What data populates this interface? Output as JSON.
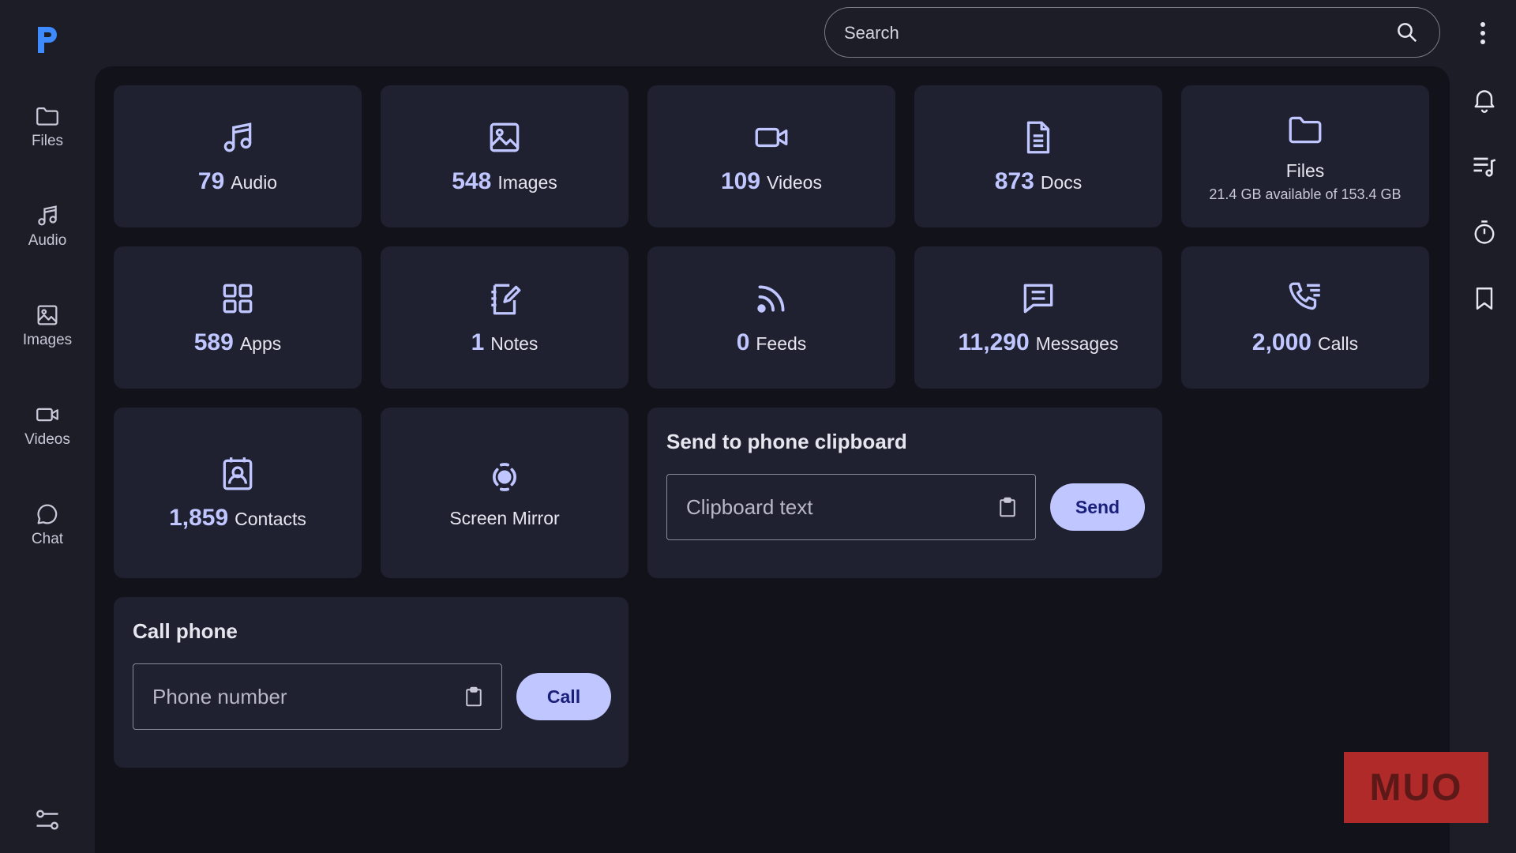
{
  "colors": {
    "accent": "#c0c6ff",
    "surface": "#1f2030",
    "background": "#12121a",
    "sidebar": "#1c1d26"
  },
  "nav": {
    "logo": "p-logo",
    "items": [
      {
        "label": "Files",
        "icon": "folder-icon"
      },
      {
        "label": "Audio",
        "icon": "music-note-icon"
      },
      {
        "label": "Images",
        "icon": "image-icon"
      },
      {
        "label": "Videos",
        "icon": "video-camera-icon"
      },
      {
        "label": "Chat",
        "icon": "chat-bubble-icon"
      }
    ],
    "settings_icon": "sliders-icon"
  },
  "search": {
    "placeholder": "Search",
    "icon": "search-icon"
  },
  "right_bar": {
    "icons": [
      "bell-icon",
      "playlist-icon",
      "timer-icon",
      "bookmark-icon"
    ],
    "menu_icon": "more-vertical-icon"
  },
  "stats": [
    {
      "count": "79",
      "label": "Audio",
      "icon": "music-note-icon"
    },
    {
      "count": "548",
      "label": "Images",
      "icon": "image-icon"
    },
    {
      "count": "109",
      "label": "Videos",
      "icon": "video-camera-icon"
    },
    {
      "count": "873",
      "label": "Docs",
      "icon": "document-icon"
    },
    {
      "label": "Files",
      "sub": "21.4 GB available of 153.4 GB",
      "icon": "folder-icon"
    },
    {
      "count": "589",
      "label": "Apps",
      "icon": "apps-grid-icon"
    },
    {
      "count": "1",
      "label": "Notes",
      "icon": "notes-icon"
    },
    {
      "count": "0",
      "label": "Feeds",
      "icon": "rss-feed-icon"
    },
    {
      "count": "11,290",
      "label": "Messages",
      "icon": "message-icon"
    },
    {
      "count": "2,000",
      "label": "Calls",
      "icon": "call-log-icon"
    },
    {
      "count": "1,859",
      "label": "Contacts",
      "icon": "contact-icon"
    },
    {
      "label": "Screen Mirror",
      "icon": "screen-mirror-icon"
    }
  ],
  "clipboard": {
    "title": "Send to phone clipboard",
    "placeholder": "Clipboard text",
    "button": "Send",
    "icon": "clipboard-icon"
  },
  "call": {
    "title": "Call phone",
    "placeholder": "Phone number",
    "button": "Call",
    "icon": "clipboard-icon"
  },
  "watermark": "MUO"
}
